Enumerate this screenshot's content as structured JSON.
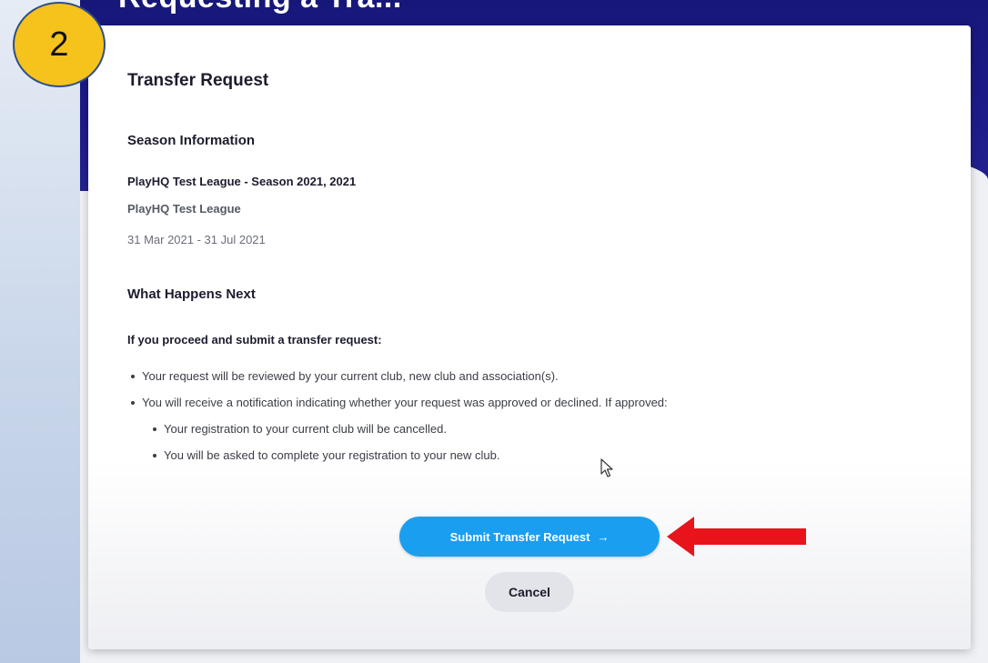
{
  "page": {
    "header_partial": "Requesting a Tra..."
  },
  "badge": {
    "number": "2"
  },
  "card": {
    "title": "Transfer Request",
    "season": {
      "heading": "Season Information",
      "season_name": "PlayHQ Test League - Season 2021, 2021",
      "league": "PlayHQ Test League",
      "dates": "31 Mar 2021 - 31 Jul 2021"
    },
    "next": {
      "heading": "What Happens Next",
      "intro": "If you proceed and submit a transfer request:",
      "bullets": [
        "Your request will be reviewed by your current club, new club and association(s).",
        "You will receive a notification indicating whether your request was approved or declined. If approved:"
      ],
      "sub_bullets": [
        "Your registration to your current club will be cancelled.",
        "You will be asked to complete your registration to your new club."
      ]
    },
    "actions": {
      "submit_label": "Submit Transfer Request",
      "submit_arrow": "→",
      "cancel_label": "Cancel"
    }
  },
  "colors": {
    "navy": "#1d1b8a",
    "primary_button": "#1a9ef0",
    "annotation_red": "#e8141b",
    "badge_yellow": "#f6c21c"
  },
  "icons": {
    "cursor": "mouse-pointer-icon",
    "submit_arrow": "arrow-right-icon",
    "annotation": "red-arrow-left-icon"
  }
}
